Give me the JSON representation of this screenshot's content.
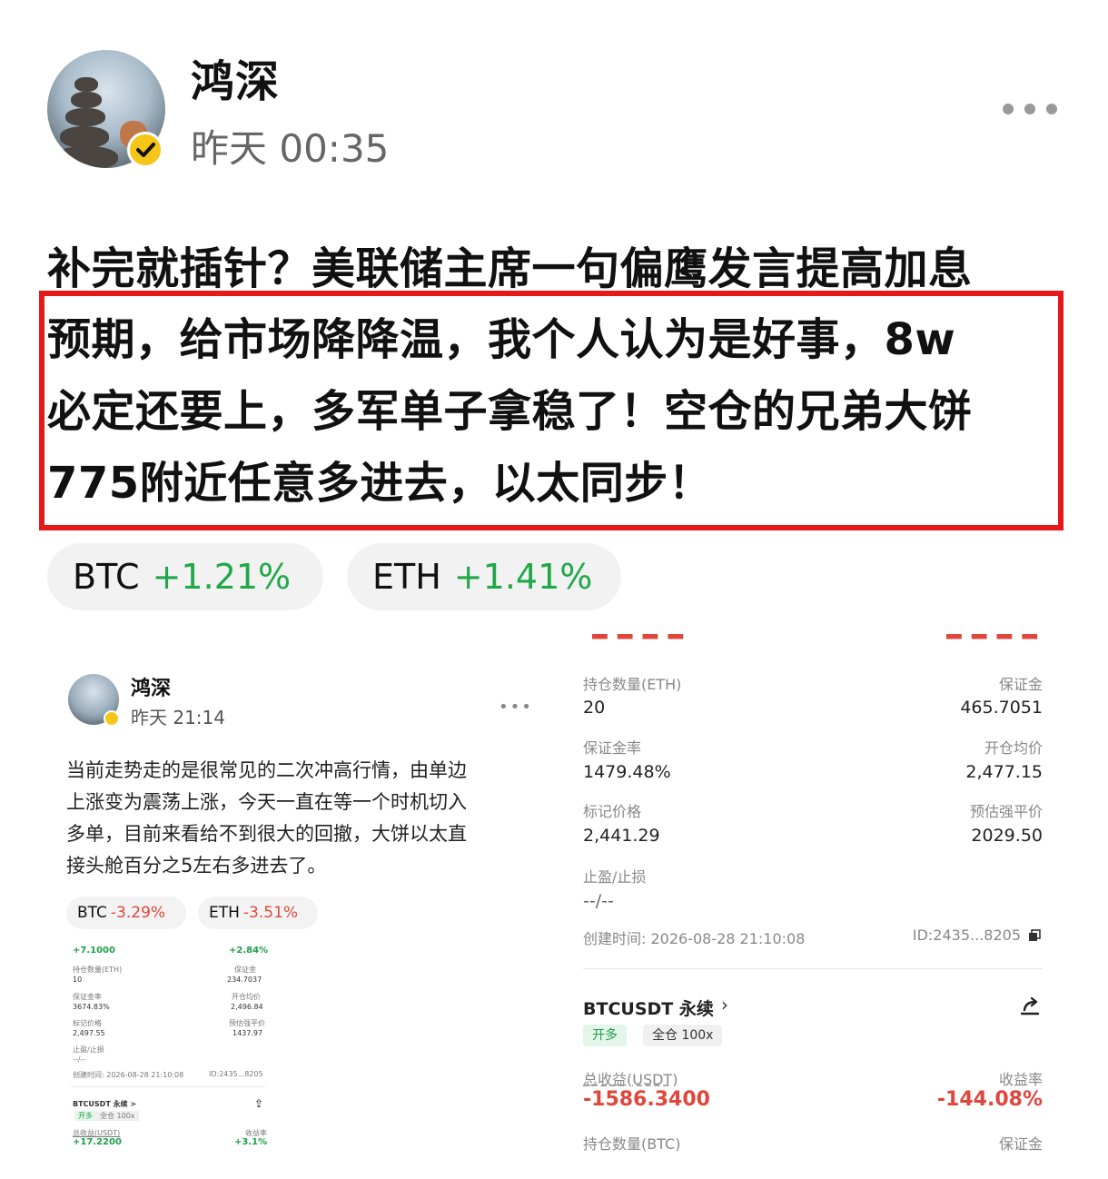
{
  "post": {
    "username": "鸿深",
    "time": "昨天 00:35",
    "lines": [
      "补完就插针？美联储主席一句偏鹰发言提高加息",
      "预期，给市场降降温，我个人认为是好事，8w",
      "必定还要上，多军单子拿稳了！空仓的兄弟大饼",
      "775附近任意多进去，以太同步！"
    ],
    "tickers": [
      {
        "symbol": "BTC",
        "change": "+1.21%"
      },
      {
        "symbol": "ETH",
        "change": "+1.41%"
      }
    ]
  },
  "embedded_post": {
    "username": "鸿深",
    "time": "昨天 21:14",
    "lines": [
      "当前走势走的是很常见的二次冲高行情，由单边",
      "上涨变为震荡上涨，今天一直在等一个时机切入",
      "多单，目前来看给不到很大的回撤，大饼以太直",
      "接头舱百分之5左右多进去了。"
    ],
    "tickers": [
      {
        "symbol": "BTC",
        "change": "-3.29%"
      },
      {
        "symbol": "ETH",
        "change": "-3.51%"
      }
    ],
    "mini_position": {
      "top_left": "+7.1000",
      "top_right": "+2.84%",
      "qty_label": "持仓数量(ETH)",
      "qty": "10",
      "margin_label": "保证金",
      "margin": "234.7037",
      "ratio_label": "保证金率",
      "ratio": "3674.83%",
      "open_label": "开仓均价",
      "open": "2,496.84",
      "mark_label": "标记价格",
      "mark": "2,497.55",
      "liq_label": "预估强平价",
      "liq": "1437.97",
      "tpsl_label": "止盈/止损",
      "tpsl": "--/--",
      "created": "创建时间: 2026-08-28 21:10:08",
      "id": "ID:2435...8205",
      "contract": "BTCUSDT 永续 >",
      "tag1": "开多",
      "tag2": "全仓 100x",
      "pnl_label": "总收益(USDT)",
      "pnl": "+17.2200",
      "rate_label": "收益率",
      "rate": "+3.1%"
    }
  },
  "position": {
    "qty_label": "持仓数量(ETH)",
    "qty": "20",
    "margin_label": "保证金",
    "margin": "465.7051",
    "ratio_label": "保证金率",
    "ratio": "1479.48%",
    "open_label": "开仓均价",
    "open": "2,477.15",
    "mark_label": "标记价格",
    "mark": "2,441.29",
    "liq_label": "预估强平价",
    "liq": "2029.50",
    "tpsl_label": "止盈/止损",
    "tpsl": "--/--",
    "created": "创建时间: 2026-08-28 21:10:08",
    "id": "ID:2435...8205",
    "contract": "BTCUSDT 永续",
    "tag1": "开多",
    "tag2": "全仓 100x",
    "pnl_label": "总收益(USDT)",
    "pnl": "-1586.3400",
    "rate_label": "收益率",
    "rate": "-144.08%",
    "next_qty_label": "持仓数量(BTC)",
    "next_margin_label": "保证金"
  },
  "colors": {
    "up": "#20a848",
    "down": "#e0463c",
    "highlight": "#e51919",
    "verified": "#f5c518"
  },
  "icons": [
    "more-icon",
    "verified-icon",
    "share-icon",
    "copy-icon",
    "chevron-right-icon"
  ]
}
